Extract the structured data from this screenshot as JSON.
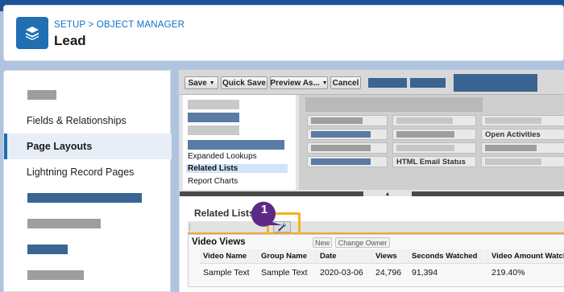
{
  "breadcrumb": {
    "setup": "SETUP",
    "separator": " > ",
    "object_manager": "OBJECT MANAGER"
  },
  "header": {
    "title": "Lead",
    "icon": "layers-icon"
  },
  "sidebar": {
    "items": [
      {
        "label": "Fields & Relationships",
        "active": false
      },
      {
        "label": "Page Layouts",
        "active": true
      },
      {
        "label": "Lightning Record Pages",
        "active": false
      }
    ]
  },
  "toolbar": {
    "save": "Save",
    "quick_save": "Quick Save",
    "preview_as": "Preview As...",
    "cancel": "Cancel",
    "dropdown_arrow": "▼"
  },
  "palette": {
    "categories": [
      "Expanded Lookups",
      "Related Lists",
      "Report Charts"
    ],
    "selected": "Related Lists",
    "fields": [
      "Open Activities",
      "HTML Email Status"
    ]
  },
  "related_lists": {
    "section_title": "Related Lists",
    "callout_number": "1",
    "wrench": "wrench-icon"
  },
  "video_views": {
    "title": "Video Views",
    "new_button": "New",
    "change_owner_button": "Change Owner",
    "columns": [
      "Video Name",
      "Group Name",
      "Date",
      "Views",
      "Seconds Watched",
      "Video Amount Watched"
    ],
    "row": [
      "Sample Text",
      "Sample Text",
      "2020-03-06",
      "24,796",
      "91,394",
      "219.40%"
    ]
  },
  "colors": {
    "accent": "#1f6fb2",
    "redacted_blue": "#3a6491",
    "redacted_gray": "#9e9e9e",
    "highlight": "#f2b320",
    "callout": "#5c2a86"
  }
}
